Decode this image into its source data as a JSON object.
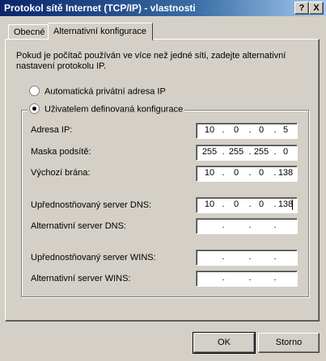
{
  "window": {
    "title": "Protokol sítě Internet (TCP/IP) - vlastnosti",
    "help_label": "?",
    "close_label": "X"
  },
  "tabs": [
    {
      "label": "Obecné",
      "active": false
    },
    {
      "label": "Alternativní konfigurace",
      "active": true
    }
  ],
  "description": "Pokud je počítač používán ve více než jedné síti, zadejte alternativní nastavení protokolu IP.",
  "radios": {
    "auto": {
      "label": "Automatická privátní adresa IP",
      "checked": false
    },
    "user": {
      "label": "Uživatelem definovaná konfigurace",
      "checked": true
    }
  },
  "fields": [
    {
      "label": "Adresa IP:",
      "octets": [
        "10",
        "0",
        "0",
        "5"
      ]
    },
    {
      "label": "Maska podsítě:",
      "octets": [
        "255",
        "255",
        "255",
        "0"
      ]
    },
    {
      "label": "Výchozí brána:",
      "octets": [
        "10",
        "0",
        "0",
        "138"
      ]
    },
    {
      "label": "Upřednostňovaný server DNS:",
      "octets": [
        "10",
        "0",
        "0",
        "138"
      ]
    },
    {
      "label": "Alternativní server DNS:",
      "octets": [
        "",
        "",
        "",
        ""
      ]
    },
    {
      "label": "Upřednostňovaný server WINS:",
      "octets": [
        "",
        "",
        "",
        ""
      ]
    },
    {
      "label": "Alternativní server WINS:",
      "octets": [
        "",
        "",
        "",
        ""
      ]
    }
  ],
  "buttons": {
    "ok": "OK",
    "cancel": "Storno"
  }
}
